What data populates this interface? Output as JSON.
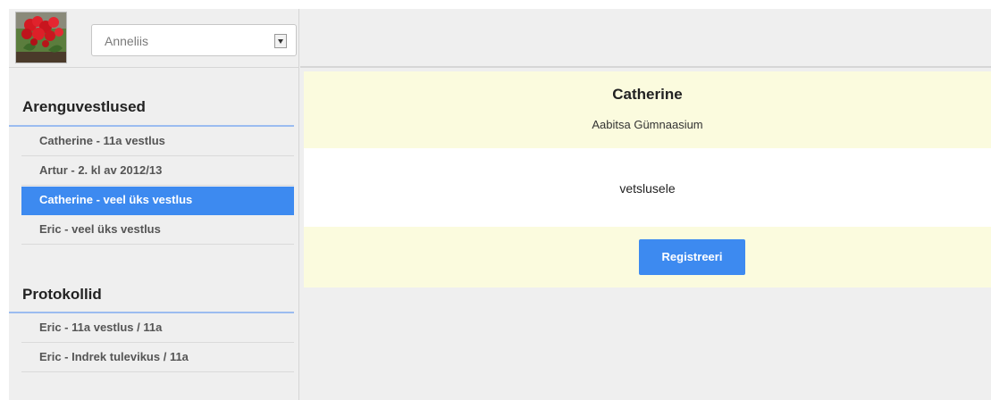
{
  "user_select": {
    "value": "Anneliis"
  },
  "sidebar": {
    "sections": [
      {
        "title": "Arenguvestlused",
        "items": [
          {
            "label": "Catherine - 11a vestlus",
            "active": false
          },
          {
            "label": "Artur - 2. kl av 2012/13",
            "active": false
          },
          {
            "label": "Catherine - veel üks vestlus",
            "active": true
          },
          {
            "label": "Eric - veel üks vestlus",
            "active": false
          }
        ]
      },
      {
        "title": "Protokollid",
        "items": [
          {
            "label": "Eric - 11a vestlus / 11a",
            "active": false
          },
          {
            "label": "Eric - Indrek tulevikus / 11a",
            "active": false
          }
        ]
      }
    ]
  },
  "main": {
    "name": "Catherine",
    "school": "Aabitsa Gümnaasium",
    "message": "vetslusele",
    "register_label": "Registreeri"
  },
  "colors": {
    "accent": "#3d8af0",
    "highlight_band": "#fbfbde",
    "sidebar_bg": "#efefef"
  }
}
